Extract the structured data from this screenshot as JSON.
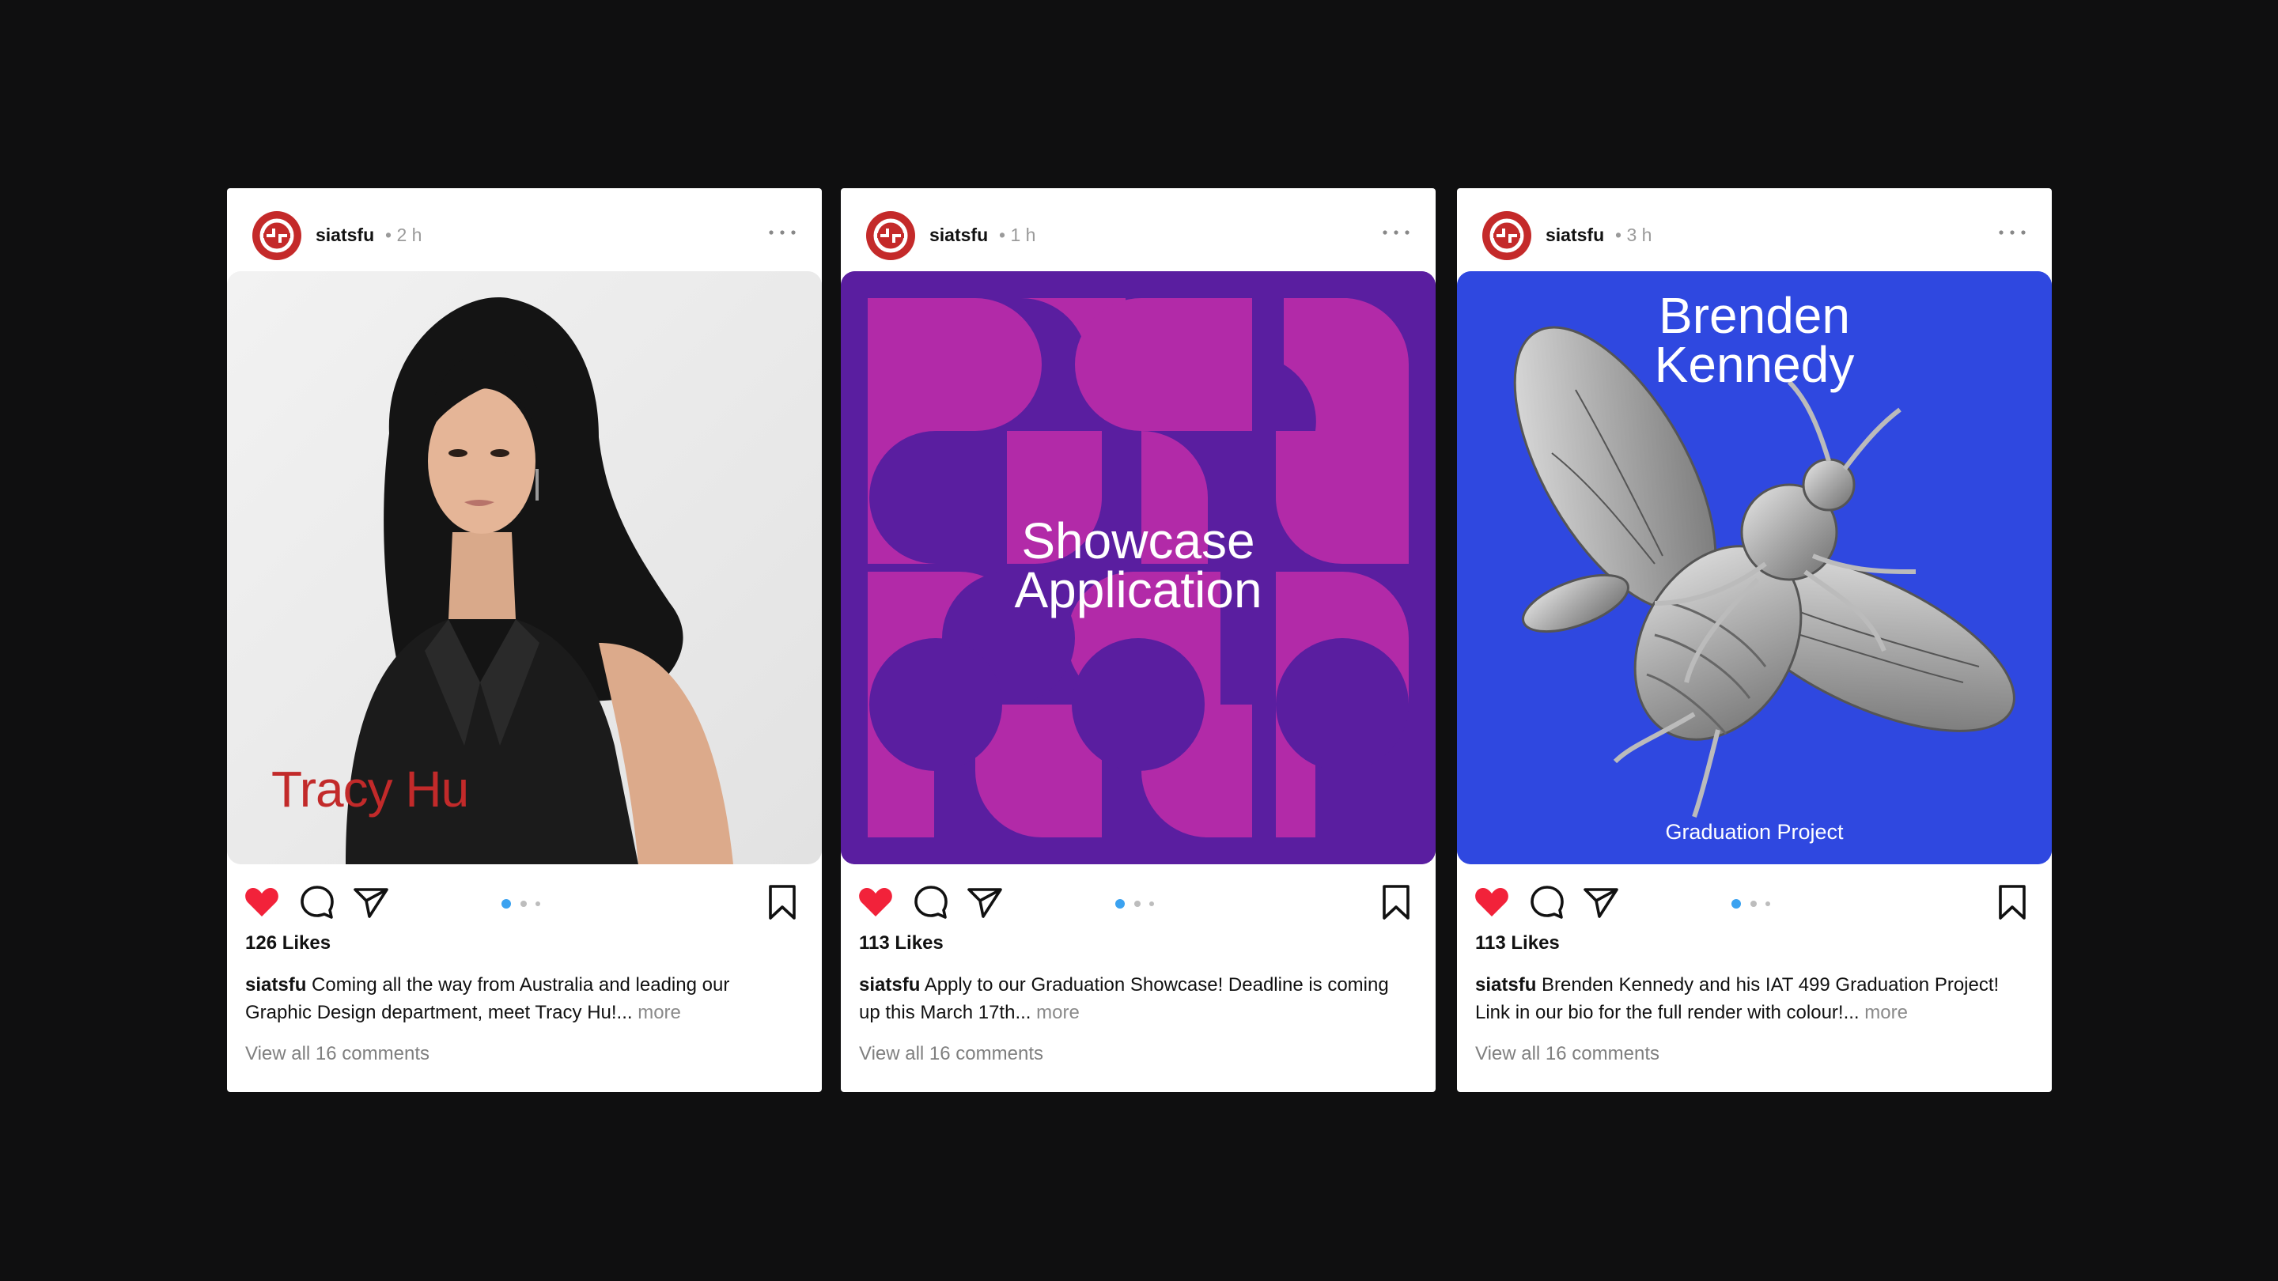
{
  "colors": {
    "background": "#0f0f10",
    "card": "#ffffff",
    "brand_red": "#c42a2a",
    "like_red": "#f2223a",
    "dot_active": "#3ba2f0",
    "dot_inactive": "#bdbdbd"
  },
  "posts": [
    {
      "username": "siatsfu",
      "time": "2 h",
      "overlay_text": "Tracy Hu",
      "likes": "126 Likes",
      "caption_user": "siatsfu",
      "caption_line1": "Coming all the way from Australia and leading our",
      "caption_line2": "Graphic Design department, meet Tracy Hu!...",
      "more": "more",
      "comments": "View all 16 comments",
      "carousel_index": 1,
      "carousel_count": 3
    },
    {
      "username": "siatsfu",
      "time": "1 h",
      "overlay_text_line1": "Showcase",
      "overlay_text_line2": "Application",
      "likes": "113 Likes",
      "caption_user": "siatsfu",
      "caption_line1": "Apply to our Graduation Showcase! Deadline is coming",
      "caption_line2": "up this March 17th...",
      "more": "more",
      "comments": "View all 16 comments",
      "carousel_index": 1,
      "carousel_count": 3
    },
    {
      "username": "siatsfu",
      "time": "3 h",
      "overlay_text_line1": "Brenden",
      "overlay_text_line2": "Kennedy",
      "overlay_sub": "Graduation Project",
      "likes": "113 Likes",
      "caption_user": "siatsfu",
      "caption_line1": "Brenden Kennedy and his IAT 499 Graduation Project!",
      "caption_line2": "Link in our bio for the full render with colour!...",
      "more": "more",
      "comments": "View all 16 comments",
      "carousel_index": 1,
      "carousel_count": 3
    }
  ],
  "icons": {
    "avatar": "siat-logo-icon",
    "like": "heart-icon",
    "comment": "comment-bubble-icon",
    "share": "paper-plane-icon",
    "save": "bookmark-icon",
    "more": "more-dots-icon"
  }
}
